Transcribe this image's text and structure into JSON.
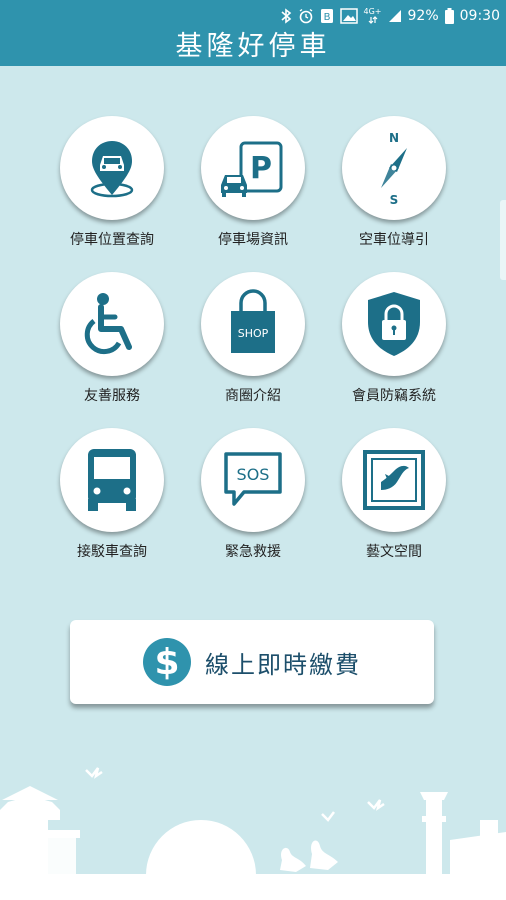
{
  "status_bar": {
    "battery": "92%",
    "time": "09:30",
    "network": "4G+"
  },
  "app": {
    "title": "基隆好停車"
  },
  "menu": {
    "items": [
      {
        "label": "停車位置查詢",
        "icon": "car-location-pin-icon"
      },
      {
        "label": "停車場資訊",
        "icon": "parking-lot-icon"
      },
      {
        "label": "空車位導引",
        "icon": "compass-icon"
      },
      {
        "label": "友善服務",
        "icon": "wheelchair-icon"
      },
      {
        "label": "商圈介紹",
        "icon": "shopping-bag-icon"
      },
      {
        "label": "會員防竊系統",
        "icon": "shield-lock-icon"
      },
      {
        "label": "接駁車查詢",
        "icon": "bus-icon"
      },
      {
        "label": "緊急救援",
        "icon": "sos-bubble-icon"
      },
      {
        "label": "藝文空間",
        "icon": "art-frame-icon"
      }
    ],
    "parking_letter": "P",
    "compass_n": "N",
    "compass_s": "S",
    "shop_text": "SHOP",
    "sos_text": "SOS"
  },
  "payment": {
    "label": "線上即時繳費",
    "symbol": "$"
  },
  "colors": {
    "primary": "#2f93ad",
    "background": "#cde8ec",
    "icon_dark": "#1d6f88"
  }
}
